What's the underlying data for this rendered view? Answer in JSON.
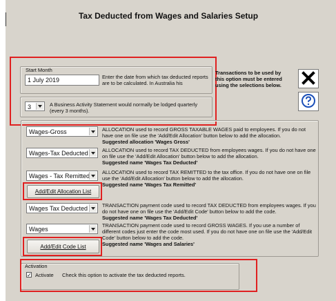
{
  "window": {
    "title": "Tax Deducted from Wages and Salaries Setup"
  },
  "start": {
    "group_label": "Start Month",
    "value": "1 July 2019",
    "help": "Enter the date from which tax deducted reports are to be calculated. In Australia his",
    "bas_value": "3",
    "bas_help": "A Business Activity Statement would normally be lodged quarterly (every 3 months)."
  },
  "transactions_note": "Transactions to be used by this option must be entered using the selections below.",
  "icons": {
    "close": "close-icon",
    "help": "help-icon"
  },
  "allocations": [
    {
      "value": "Wages-Gross",
      "desc": "ALLOCATION used to record GROSS TAXABLE WAGES paid to employees. If you do not have one on file use the 'Add/Edit Allocation' button below to add the allocation.",
      "suggest": "Suggested allocation 'Wages Gross'"
    },
    {
      "value": "Wages-Tax Deducted",
      "desc": "ALLOCATION used to record TAX DEDUCTED from employees wages. If you do not have one on file use the 'Add/Edit Allocation' button below to add the allocation.",
      "suggest": "Suggested name 'Wages Tax Deducted'"
    },
    {
      "value": "Wages - Tax Remitted",
      "desc": "ALLOCATION used to record TAX REMITTED to the tax office. If you do not have one on file use the 'Add/Edit Allocation' button below to add the allocation.",
      "suggest": "Suggested name 'Wages Tax Remitted'"
    }
  ],
  "add_edit_allocation_label": "Add/Edit Allocation List",
  "codes": [
    {
      "value": "Wages Tax Deducted",
      "desc": "TRANSACTION payment code used to record TAX DEDUCTED from employees wages. If you do not have one on file use the 'Add/Edit Code' button below to add the code.",
      "suggest": "Suggested name 'Wages Tax Deducted'"
    },
    {
      "value": "Wages",
      "desc": "TRANSACTION payment code used to record GROSS WAGES. If you use a number of different codes just enter the code most used. If you do not have one on file use the 'Add/Edit Code' button below to add the code.",
      "suggest": "Suggested name 'Wages and Salaries'"
    }
  ],
  "add_edit_code_label": "Add/Edit Code List",
  "activation": {
    "group_label": "Activation",
    "checkbox_label": "Activate",
    "checked_mark": "✓",
    "help": "Check this option to activate the tax deducted reports."
  },
  "colors": {
    "highlight": "#e02020",
    "dialog_bg": "#d8d4cc"
  }
}
